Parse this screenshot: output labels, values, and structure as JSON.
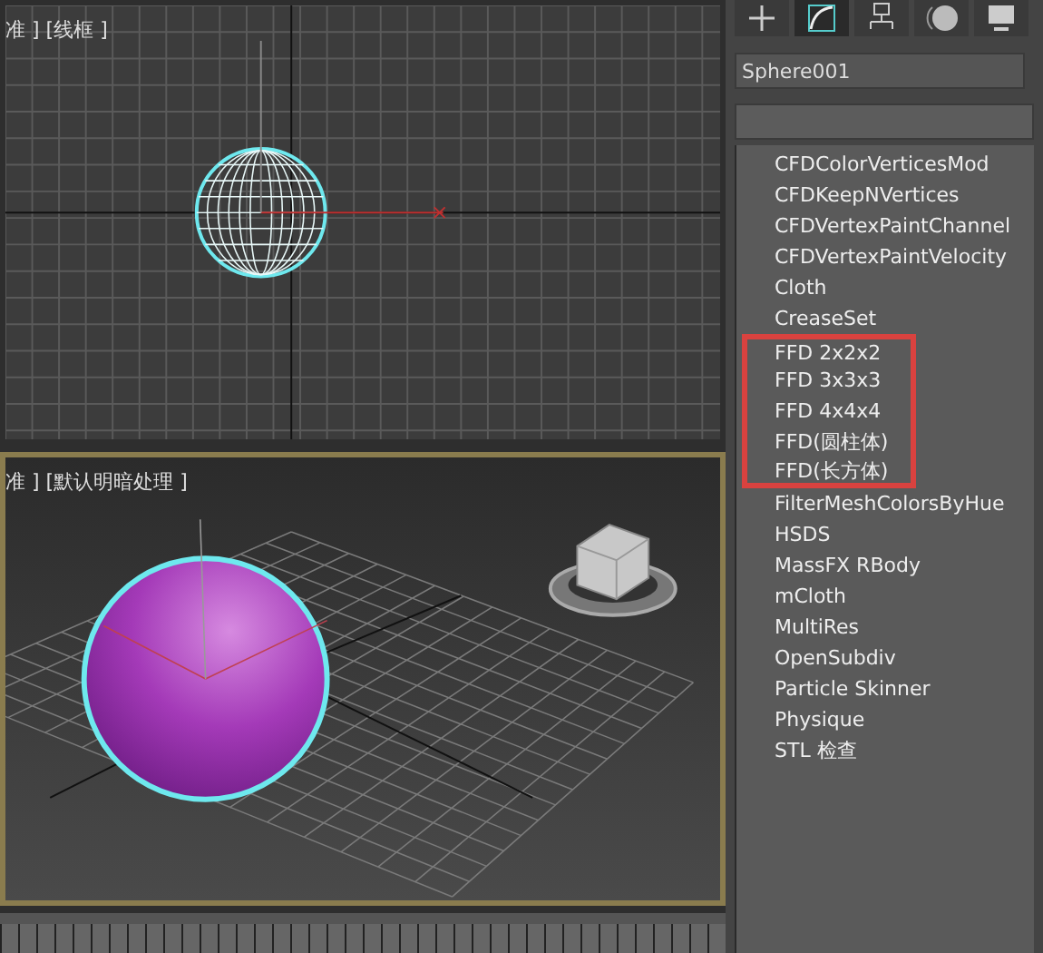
{
  "viewports": [
    {
      "kind": "wireframe",
      "label": "准 ] [线框 ]",
      "active": false
    },
    {
      "kind": "shaded",
      "label": "准 ] [默认明暗处理 ]",
      "active": true
    }
  ],
  "command_tabs": [
    {
      "kind": "create",
      "selected": false
    },
    {
      "kind": "modify",
      "selected": true
    },
    {
      "kind": "hierarchy",
      "selected": false
    },
    {
      "kind": "motion",
      "selected": false
    },
    {
      "kind": "display",
      "selected": false
    }
  ],
  "object_name": "Sphere001",
  "modifier_list": [
    {
      "label": "CFDColorVerticesMod",
      "highlighted": false
    },
    {
      "label": "CFDKeepNVertices",
      "highlighted": false
    },
    {
      "label": "CFDVertexPaintChannel",
      "highlighted": false
    },
    {
      "label": "CFDVertexPaintVelocity",
      "highlighted": false
    },
    {
      "label": "Cloth",
      "highlighted": false
    },
    {
      "label": "CreaseSet",
      "highlighted": false
    },
    {
      "label": "FFD 2x2x2",
      "highlighted": true
    },
    {
      "label": "FFD 3x3x3",
      "highlighted": true
    },
    {
      "label": "FFD 4x4x4",
      "highlighted": true
    },
    {
      "label": "FFD(圆柱体)",
      "highlighted": true
    },
    {
      "label": "FFD(长方体)",
      "highlighted": true
    },
    {
      "label": "FilterMeshColorsByHue",
      "highlighted": false
    },
    {
      "label": "HSDS",
      "highlighted": false
    },
    {
      "label": "MassFX RBody",
      "highlighted": false
    },
    {
      "label": "mCloth",
      "highlighted": false
    },
    {
      "label": "MultiRes",
      "highlighted": false
    },
    {
      "label": "OpenSubdiv",
      "highlighted": false
    },
    {
      "label": "Particle Skinner",
      "highlighted": false
    },
    {
      "label": "Physique",
      "highlighted": false
    },
    {
      "label": "STL 检查",
      "highlighted": false
    }
  ]
}
